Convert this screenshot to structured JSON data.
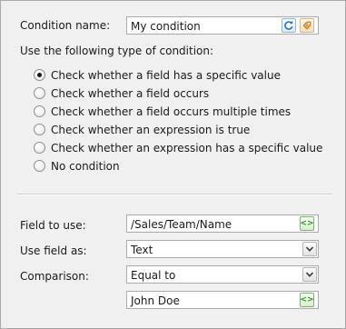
{
  "condition": {
    "name_label": "Condition name:",
    "name_value": "My condition",
    "type_prompt": "Use the following type of condition:",
    "types": [
      {
        "label": "Check whether a field has a specific value",
        "selected": true
      },
      {
        "label": "Check whether a field occurs",
        "selected": false
      },
      {
        "label": "Check whether a field occurs multiple times",
        "selected": false
      },
      {
        "label": "Check whether an expression is true",
        "selected": false
      },
      {
        "label": "Check whether an expression has a specific value",
        "selected": false
      },
      {
        "label": "No condition",
        "selected": false
      }
    ]
  },
  "field": {
    "field_label": "Field to use:",
    "field_value": "/Sales/Team/Name",
    "use_as_label": "Use field as:",
    "use_as_value": "Text",
    "comparison_label": "Comparison:",
    "comparison_value": "Equal to",
    "compare_value": "John Doe"
  },
  "icons": {
    "refresh": "refresh-icon",
    "tag": "tag-icon",
    "code": "code-brackets-icon",
    "dropdown": "chevron-down-icon"
  }
}
